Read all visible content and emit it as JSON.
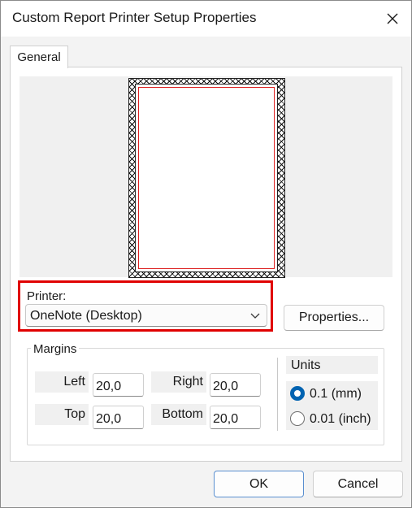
{
  "window": {
    "title": "Custom Report Printer Setup Properties",
    "close_icon": "close-icon"
  },
  "tabs": [
    {
      "label": "General",
      "selected": true
    }
  ],
  "printer": {
    "label": "Printer:",
    "selected_value": "OneNote (Desktop)",
    "properties_label": "Properties..."
  },
  "margins": {
    "legend": "Margins",
    "left_label": "Left",
    "left_value": "20,0",
    "right_label": "Right",
    "right_value": "20,0",
    "top_label": "Top",
    "top_value": "20,0",
    "bottom_label": "Bottom",
    "bottom_value": "20,0"
  },
  "units": {
    "label": "Units",
    "options": [
      {
        "label": "0.1 (mm)",
        "checked": true
      },
      {
        "label": "0.01 (inch)",
        "checked": false
      }
    ]
  },
  "footer": {
    "ok_label": "OK",
    "cancel_label": "Cancel"
  },
  "colors": {
    "highlight": "#e00000",
    "accent": "#0063b1",
    "page_margin_line": "#dd2222"
  }
}
